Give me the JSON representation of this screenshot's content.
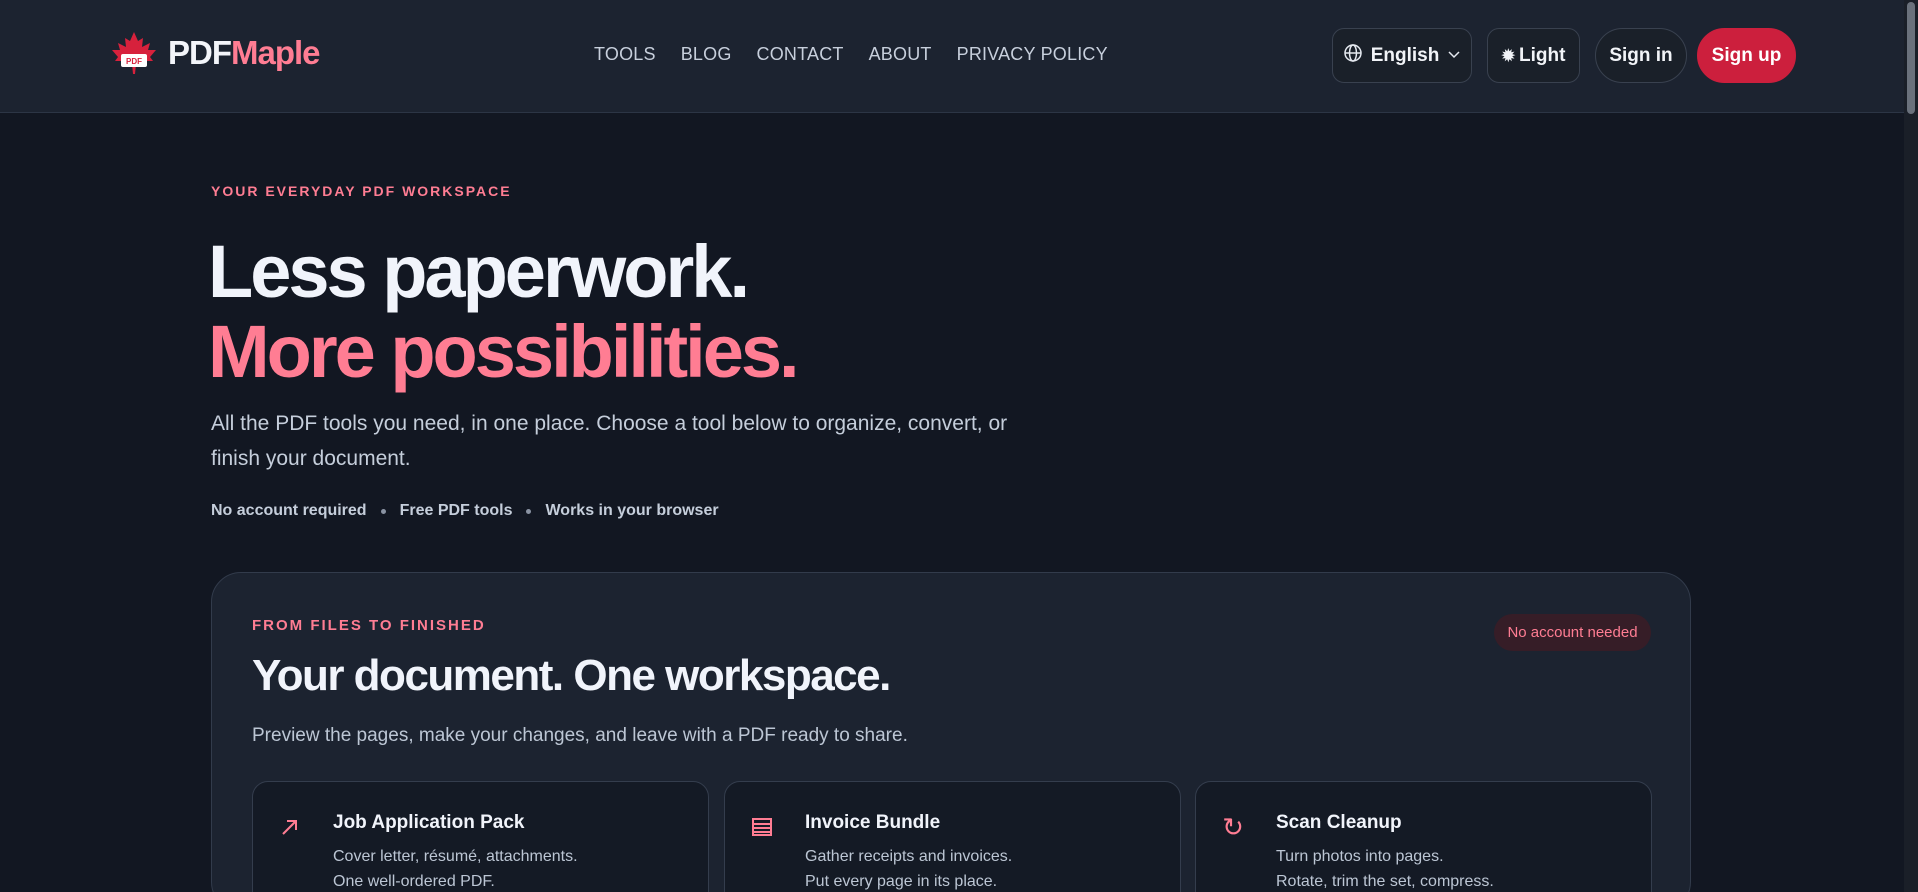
{
  "header": {
    "logo": {
      "part1": "PDF",
      "part2": "Maple",
      "mark_text": "PDF"
    },
    "nav": [
      {
        "label": "TOOLS"
      },
      {
        "label": "BLOG"
      },
      {
        "label": "CONTACT"
      },
      {
        "label": "ABOUT"
      },
      {
        "label": "PRIVACY POLICY"
      }
    ],
    "language": {
      "label": "English",
      "icon": "globe-icon"
    },
    "theme": {
      "label": "Light",
      "icon": "sun-icon"
    },
    "sign_in": "Sign in",
    "sign_up": "Sign up"
  },
  "hero": {
    "eyebrow": "YOUR EVERYDAY PDF WORKSPACE",
    "title_line1": "Less paperwork.",
    "title_line2": "More possibilities.",
    "description": "All the PDF tools you need, in one place. Choose a tool below to organize, convert, or finish your document.",
    "badges": [
      "No account required",
      "Free PDF tools",
      "Works in your browser"
    ]
  },
  "workspace": {
    "eyebrow": "FROM FILES TO FINISHED",
    "pill": "No account needed",
    "title": "Your document. One workspace.",
    "description": "Preview the pages, make your changes, and leave with a PDF ready to share.",
    "workflows": [
      {
        "icon": "arrow-up-right-icon",
        "title": "Job Application Pack",
        "line1": "Cover letter, résumé, attachments.",
        "line2": "One well-ordered PDF."
      },
      {
        "icon": "document-lines-icon",
        "title": "Invoice Bundle",
        "line1": "Gather receipts and invoices.",
        "line2": "Put every page in its place."
      },
      {
        "icon": "rotate-icon",
        "title": "Scan Cleanup",
        "line1": "Turn photos into pages.",
        "line2": "Rotate, trim the set, compress."
      }
    ]
  },
  "colors": {
    "background": "#121722",
    "header": "#1c2330",
    "accent": "#ff7d93",
    "signup": "#cc1f3d"
  }
}
